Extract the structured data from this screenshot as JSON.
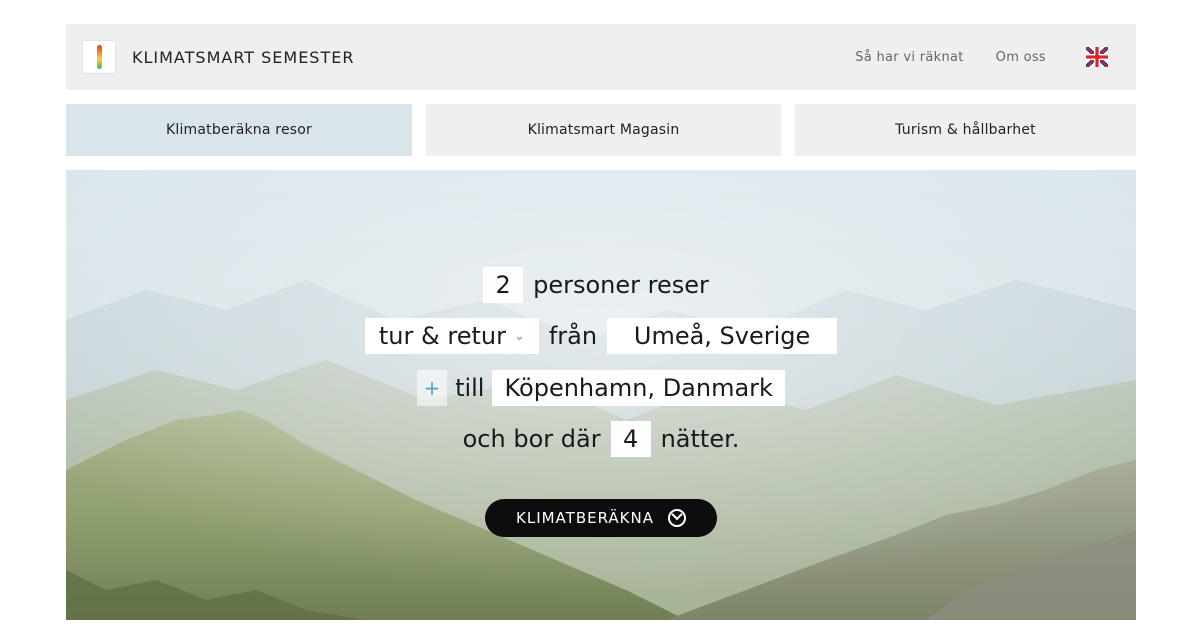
{
  "header": {
    "brand": "KLIMATSMART SEMESTER",
    "links": [
      "Så har vi räknat",
      "Om oss"
    ],
    "language_icon": "uk-flag-icon"
  },
  "tabs": [
    {
      "label": "Klimatberäkna resor",
      "active": true
    },
    {
      "label": "Klimatsmart Magasin",
      "active": false
    },
    {
      "label": "Turism & hållbarhet",
      "active": false
    }
  ],
  "form": {
    "persons": "2",
    "persons_text": "personer reser",
    "trip_type": "tur & retur",
    "from_word": "från",
    "origin": "Umeå, Sverige",
    "plus": "+",
    "to_word": "till",
    "destination": "Köpenhamn, Danmark",
    "stay_prefix": "och bor där",
    "nights": "4",
    "stay_suffix": "nätter.",
    "cta_label": "KLIMATBERÄKNA"
  },
  "colors": {
    "header_bg": "#efefef",
    "active_tab_bg": "#d9e5eb",
    "cta_bg": "#0d0d0d",
    "plus_accent": "#5aa0c8"
  }
}
